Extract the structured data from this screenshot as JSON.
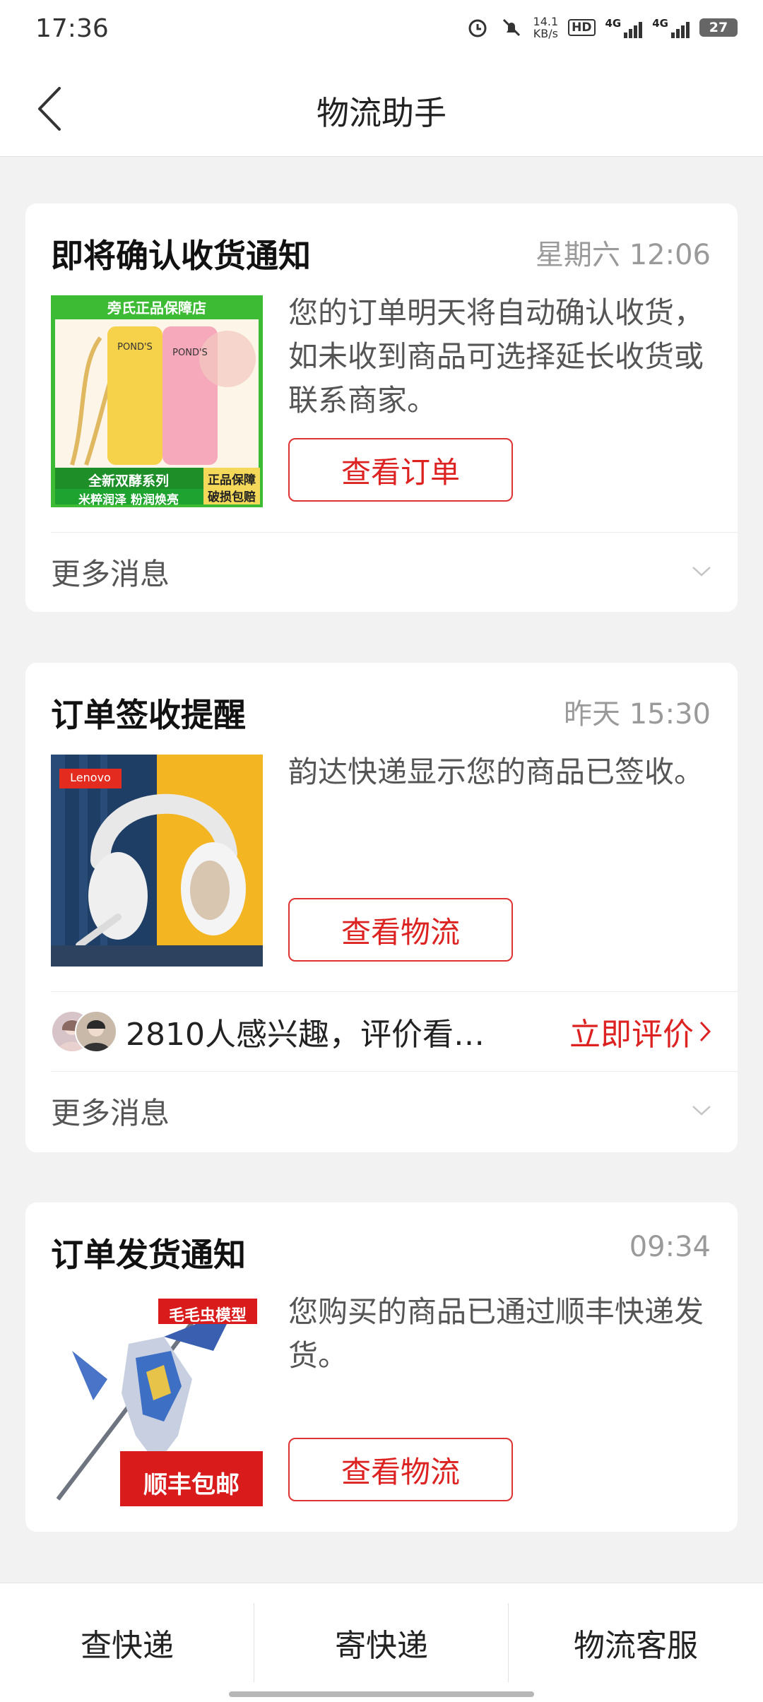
{
  "status_bar": {
    "time": "17:36",
    "speed_value": "14.1",
    "speed_unit": "KB/s",
    "hd_label": "HD",
    "network_1": "4G",
    "network_2": "4G",
    "battery": "27"
  },
  "header": {
    "title": "物流助手",
    "back_icon": "chevron-left-icon"
  },
  "cards": [
    {
      "title": "即将确认收货通知",
      "time": "星期六 12:06",
      "message": "您的订单明天将自动确认收货，如未收到商品可选择延长收货或联系商家。",
      "button": "查看订单",
      "more_label": "更多消息",
      "image": {
        "store_banner": "旁氏正品保障店",
        "brand": "POND'S",
        "series_label": "全新双酵系列",
        "tagline": "米粹润泽  粉润焕亮",
        "guarantee_1": "正品保障",
        "guarantee_2": "破损包赔"
      }
    },
    {
      "title": "订单签收提醒",
      "time": "昨天 15:30",
      "message": "韵达快递显示您的商品已签收。",
      "button": "查看物流",
      "review_text": "2810人感兴趣，评价看…",
      "review_link": "立即评价",
      "more_label": "更多消息",
      "image": {
        "brand": "Lenovo"
      }
    },
    {
      "title": "订单发货通知",
      "time": "09:34",
      "message": "您购买的商品已通过顺丰快递发货。",
      "button": "查看物流",
      "image": {
        "tag_top": "毛毛虫模型",
        "tag_bottom": "顺丰包邮"
      }
    }
  ],
  "bottom_bar": {
    "items": [
      "查快递",
      "寄快递",
      "物流客服"
    ]
  },
  "colors": {
    "accent": "#d22222",
    "background": "#f2f2f2",
    "card": "#ffffff",
    "muted_text": "#9a9a9a"
  }
}
